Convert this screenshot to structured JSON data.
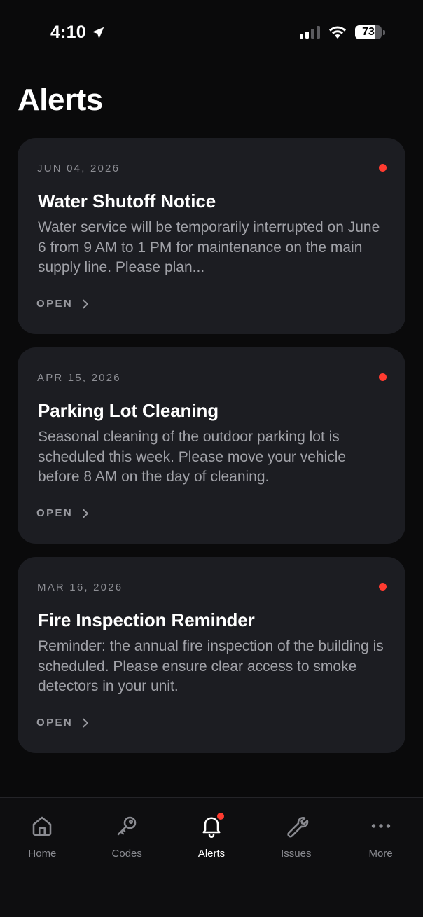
{
  "status_bar": {
    "time": "4:10",
    "battery": "73",
    "battery_level": 0.73
  },
  "header": {
    "title": "Alerts"
  },
  "alerts": [
    {
      "date": "JUN 04, 2026",
      "title": "Water Shutoff Notice",
      "body": "Water service will be temporarily interrupted on June 6 from 9 AM to 1 PM for maintenance on the main supply line. Please plan...",
      "action": "OPEN",
      "unread": true
    },
    {
      "date": "APR 15, 2026",
      "title": "Parking Lot Cleaning",
      "body": "Seasonal cleaning of the outdoor parking lot is scheduled this week. Please move your vehicle before 8 AM on the day of cleaning.",
      "action": "OPEN",
      "unread": true
    },
    {
      "date": "MAR 16, 2026",
      "title": "Fire Inspection Reminder",
      "body": "Reminder: the annual fire inspection of the building is scheduled. Please ensure clear access to smoke detectors in your unit.",
      "action": "OPEN",
      "unread": true
    }
  ],
  "tab_bar": {
    "items": [
      {
        "label": "Home",
        "icon": "home-icon",
        "active": false
      },
      {
        "label": "Codes",
        "icon": "key-icon",
        "active": false
      },
      {
        "label": "Alerts",
        "icon": "bell-icon",
        "active": true,
        "badge": true
      },
      {
        "label": "Issues",
        "icon": "wrench-icon",
        "active": false
      },
      {
        "label": "More",
        "icon": "more-icon",
        "active": false
      }
    ]
  },
  "colors": {
    "background": "#0a0a0b",
    "card": "#1c1d22",
    "accent_red": "#ff3b30",
    "text_primary": "#ffffff",
    "text_secondary": "#a1a2a8"
  }
}
